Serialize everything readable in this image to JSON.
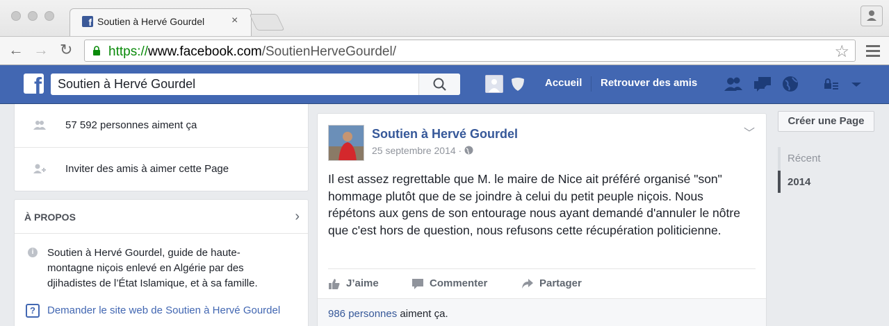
{
  "browser": {
    "tab_title": "Soutien à Hervé Gourdel",
    "tab_close": "×",
    "url_protocol": "https://",
    "url_host": "www.facebook.com",
    "url_path": "/SoutienHerveGourdel/"
  },
  "fb": {
    "logo": "f",
    "search_value": "Soutien à Hervé Gourdel",
    "nav": {
      "home": "Accueil",
      "find_friends": "Retrouver des amis"
    },
    "accent": "#4267b2"
  },
  "left": {
    "likes_row": "57 592 personnes aiment ça",
    "invite_row": "Inviter des amis à aimer cette Page",
    "about_title": "À PROPOS",
    "about_chevron": "›",
    "about_text": "Soutien à Hervé Gourdel, guide de haute-montagne niçois enlevé en Algérie par des djihadistes de l’État Islamique, et à sa famille.",
    "website_link": "Demander le site web de Soutien à Hervé Gourdel",
    "help_icon": "?",
    "info_icon": "i"
  },
  "post": {
    "author": "Soutien à Hervé Gourdel",
    "date": "25 septembre 2014 ·",
    "body": "Il est assez regrettable que M. le maire de Nice ait préféré organisé \"son\" hommage plutôt que de se joindre à celui du petit peuple niçois. Nous répétons aux gens de son entourage nous ayant demandé d'annuler le nôtre que c'est hors de question, nous refusons cette récupération politicienne.",
    "actions": {
      "like": "J’aime",
      "comment": "Commenter",
      "share": "Partager"
    },
    "likes_link": "986 personnes",
    "likes_suffix": " aiment ça."
  },
  "right": {
    "create_page": "Créer une Page",
    "timeline": [
      "Récent",
      "2014"
    ]
  }
}
